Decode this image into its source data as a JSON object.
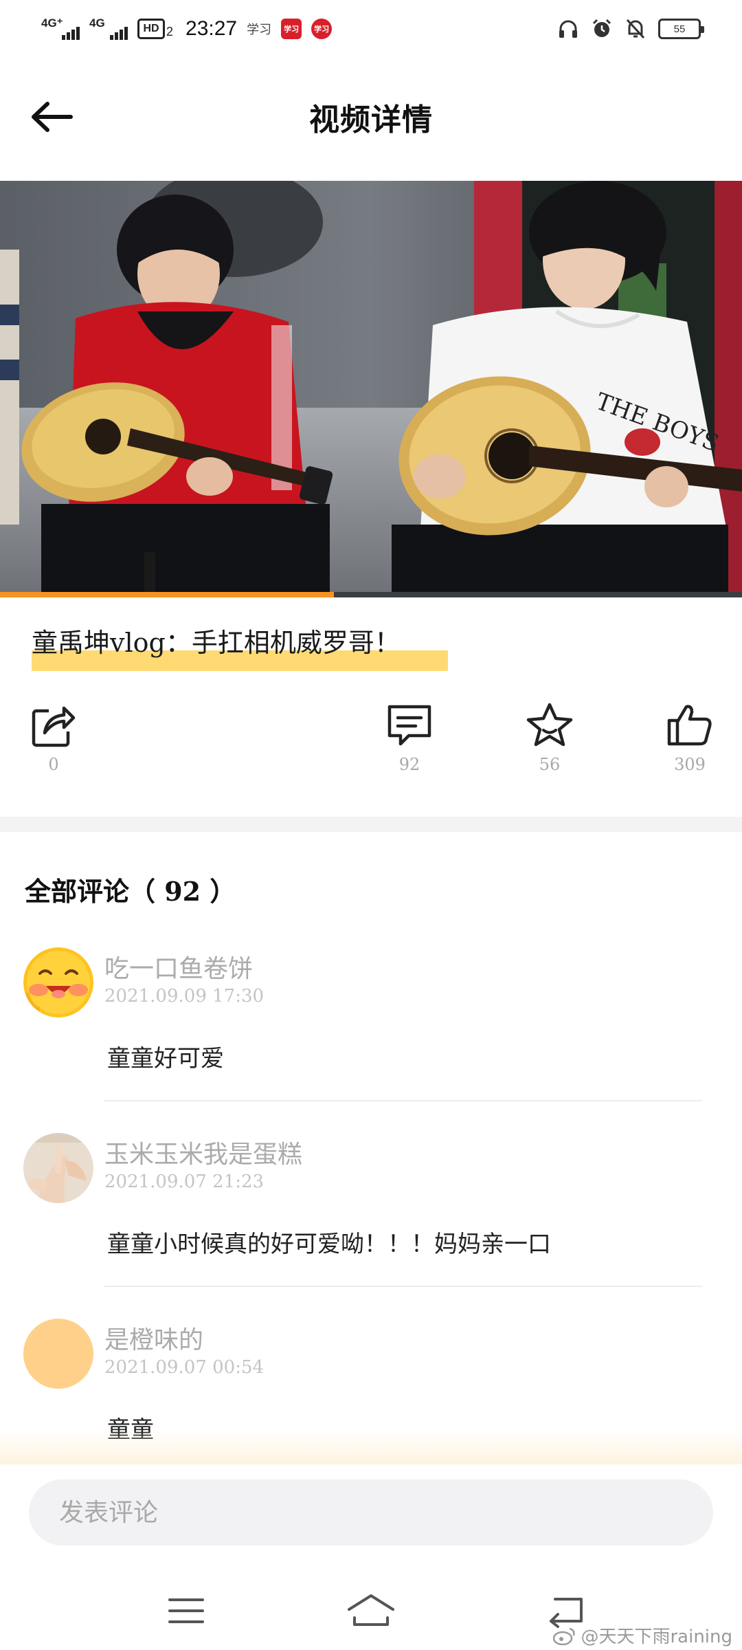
{
  "status_bar": {
    "signal_1": "4G⁺",
    "signal_2": "4G",
    "hd_badge": "HD",
    "hd_sub": "2",
    "time": "23:27",
    "app_text": "学习",
    "badge_1": "学习",
    "badge_2": "学习",
    "battery": "55",
    "icons": [
      "headphones-icon",
      "alarm-icon",
      "bell-muted-icon",
      "battery-icon"
    ]
  },
  "header": {
    "title": "视频详情",
    "back_icon": "arrow-left-icon"
  },
  "video": {
    "progress": 0.45,
    "progress_color": "#f7931e",
    "title": "童禹坤vlog：手扛相机威罗哥！",
    "title_highlight_color": "#ffd45a"
  },
  "actions": {
    "share": {
      "icon": "share-icon",
      "count": "0"
    },
    "comment": {
      "icon": "comment-icon",
      "count": "92"
    },
    "favorite": {
      "icon": "star-icon",
      "count": "56"
    },
    "like": {
      "icon": "thumbs-up-icon",
      "count": "309"
    }
  },
  "comments": {
    "header": "全部评论（ 92 ）",
    "items": [
      {
        "name": "吃一口鱼卷饼",
        "time": "2021.09.09 17:30",
        "text": "童童好可爱",
        "avatar": "blushing-emoji-avatar"
      },
      {
        "name": "玉米玉米我是蛋糕",
        "time": "2021.09.07 21:23",
        "text": "童童小时候真的好可爱呦！！！妈妈亲一口",
        "avatar": "hands-photo-avatar"
      },
      {
        "name": "是橙味的",
        "time": "2021.09.07 00:54",
        "text": "童童",
        "avatar": "orange-circle-avatar"
      }
    ]
  },
  "input": {
    "placeholder": "发表评论"
  },
  "nav_bar": {
    "menu_icon": "menu-icon",
    "home_icon": "home-icon",
    "back_icon": "return-icon",
    "watermark": "@天天下雨raining"
  },
  "colors": {
    "accent": "#f7931e",
    "highlight": "#ffd45a",
    "muted_text": "#ababab",
    "divider": "#f3f3f4"
  }
}
